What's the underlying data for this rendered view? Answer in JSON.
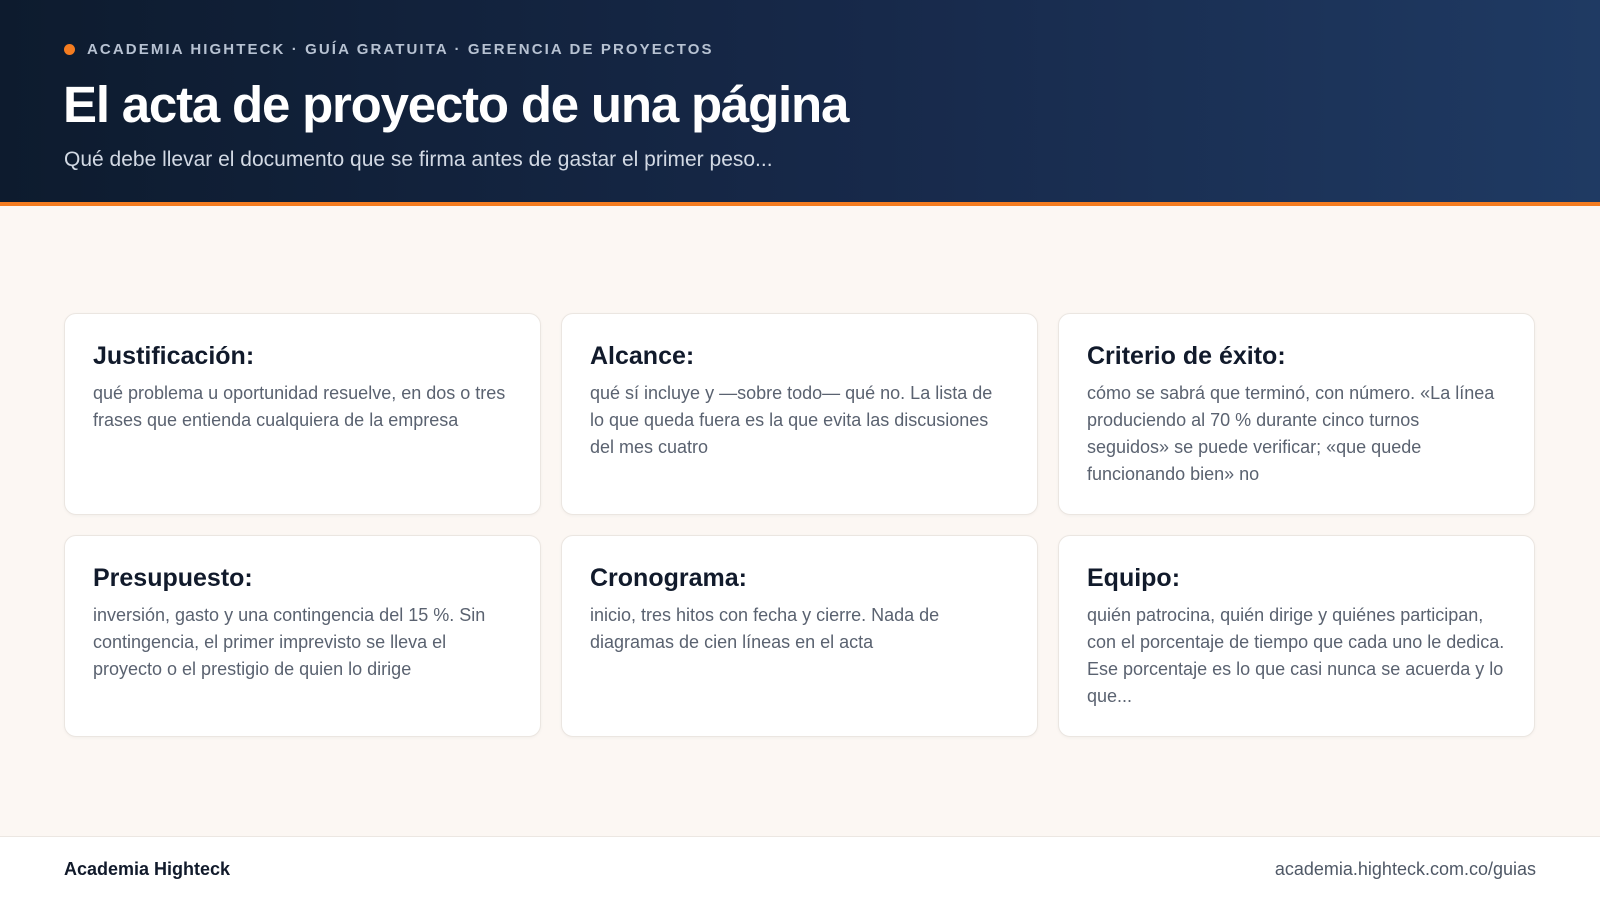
{
  "header": {
    "eyebrow": "ACADEMIA HIGHTECK · GUÍA GRATUITA · GERENCIA DE PROYECTOS",
    "title": "El acta de proyecto de una página",
    "subtitle": "Qué debe llevar el documento que se firma antes de gastar el primer peso..."
  },
  "cards": [
    {
      "title": "Justificación:",
      "body": "qué problema u oportunidad resuelve, en dos o tres frases que entienda cualquiera de la empresa"
    },
    {
      "title": "Alcance:",
      "body": "qué sí incluye y —sobre todo— qué no. La lista de lo que queda fuera es la que evita las discusiones del mes cuatro"
    },
    {
      "title": "Criterio de éxito:",
      "body": "cómo se sabrá que terminó, con número. «La línea produciendo al 70 % durante cinco turnos seguidos» se puede verificar; «que quede funcionando bien» no"
    },
    {
      "title": "Presupuesto:",
      "body": "inversión, gasto y una contingencia del 15 %. Sin contingencia, el primer imprevisto se lleva el proyecto o el prestigio de quien lo dirige"
    },
    {
      "title": "Cronograma:",
      "body": "inicio, tres hitos con fecha y cierre. Nada de diagramas de cien líneas en el acta"
    },
    {
      "title": "Equipo:",
      "body": "quién patrocina, quién dirige y quiénes participan, con el porcentaje de tiempo que cada uno le dedica. Ese porcentaje es lo que casi nunca se acuerda y lo que..."
    }
  ],
  "footer": {
    "brand": "Academia Highteck",
    "url": "academia.highteck.com.co/guias"
  },
  "colors": {
    "accent": "#f47c20",
    "header_bg": "#17294a",
    "page_bg": "#fcf7f3"
  }
}
